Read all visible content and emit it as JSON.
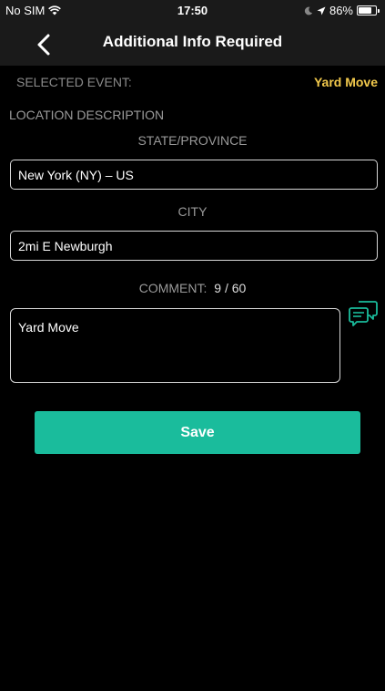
{
  "status_bar": {
    "carrier": "No SIM",
    "time": "17:50",
    "battery_percent": "86%",
    "battery_level": 0.86
  },
  "nav": {
    "title": "Additional Info Required",
    "back_icon": "chevron-left-icon"
  },
  "form": {
    "selected_event_label": "SELECTED EVENT:",
    "selected_event_value": "Yard Move",
    "location_description_label": "LOCATION DESCRIPTION",
    "state_label": "STATE/PROVINCE",
    "state_value": "New York (NY) – US",
    "city_label": "CITY",
    "city_value": "2mi E Newburgh",
    "comment_label": "COMMENT:",
    "comment_count": "9 / 60",
    "comment_value": "Yard Move",
    "chat_icon": "chat-bubbles-icon"
  },
  "actions": {
    "save_label": "Save"
  },
  "colors": {
    "accent": "#1abc9c",
    "event_value": "#f2c94c",
    "background": "#000000",
    "bar": "#1a1a1a"
  }
}
